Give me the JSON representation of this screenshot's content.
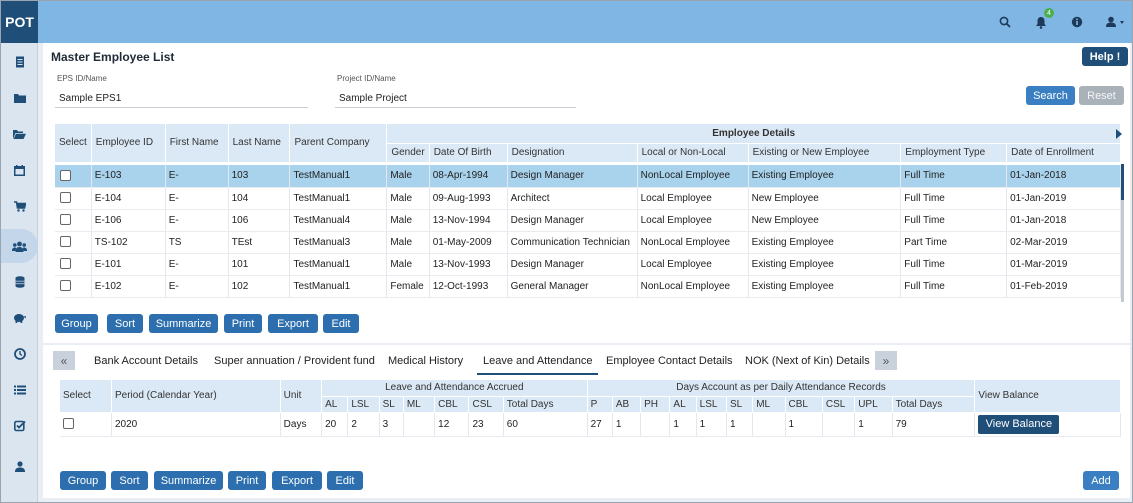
{
  "app": {
    "logo": "POT",
    "notif_count": "4"
  },
  "icons": {
    "search": "search-icon",
    "bell": "bell-icon",
    "info": "info-icon",
    "user": "user-icon"
  },
  "colors": {
    "brand": "#1f4e79",
    "topbar": "#7fb6e4",
    "header": "#dbe9f6",
    "selected_row": "#a9d2ec"
  },
  "page": {
    "title": "Master Employee List",
    "help": "Help !"
  },
  "filters": {
    "eps_label": "EPS ID/Name",
    "eps_value": "Sample EPS1",
    "project_label": "Project ID/Name",
    "project_value": "Sample Project",
    "search": "Search",
    "reset": "Reset"
  },
  "employees": {
    "columns": {
      "select": "Select",
      "id": "Employee ID",
      "first": "First Name",
      "last": "Last Name",
      "company": "Parent Company",
      "group": "Employee Details",
      "gender": "Gender",
      "dob": "Date Of Birth",
      "designation": "Designation",
      "local": "Local or Non-Local",
      "existing": "Existing or New Employee",
      "type": "Employment Type",
      "enroll": "Date of Enrollment"
    },
    "rows": [
      {
        "id": "E-103",
        "first": "E-",
        "last": "103",
        "company": "TestManual1",
        "gender": "Male",
        "dob": "08-Apr-1994",
        "designation": "Design Manager",
        "local": "NonLocal Employee",
        "existing": "Existing Employee",
        "type": "Full Time",
        "enroll": "01-Jan-2018"
      },
      {
        "id": "E-104",
        "first": "E-",
        "last": "104",
        "company": "TestManual1",
        "gender": "Male",
        "dob": "09-Aug-1993",
        "designation": "Architect",
        "local": "Local Employee",
        "existing": "New Employee",
        "type": "Full Time",
        "enroll": "01-Jan-2019"
      },
      {
        "id": "E-106",
        "first": "E-",
        "last": "106",
        "company": "TestManual4",
        "gender": "Male",
        "dob": "13-Nov-1994",
        "designation": "Design Manager",
        "local": "Local Employee",
        "existing": "New Employee",
        "type": "Full Time",
        "enroll": "01-Jan-2018"
      },
      {
        "id": "TS-102",
        "first": "TS",
        "last": "TEst",
        "company": "TestManual3",
        "gender": "Male",
        "dob": "01-May-2009",
        "designation": "Communication Technician",
        "local": "NonLocal Employee",
        "existing": "Existing Employee",
        "type": "Part Time",
        "enroll": "02-Mar-2019"
      },
      {
        "id": "E-101",
        "first": "E-",
        "last": "101",
        "company": "TestManual1",
        "gender": "Male",
        "dob": "13-Nov-1993",
        "designation": "Design Manager",
        "local": "Local Employee",
        "existing": "Existing Employee",
        "type": "Full Time",
        "enroll": "01-Mar-2019"
      },
      {
        "id": "E-102",
        "first": "E-",
        "last": "102",
        "company": "TestManual1",
        "gender": "Female",
        "dob": "12-Oct-1993",
        "designation": "General Manager",
        "local": "NonLocal Employee",
        "existing": "Existing Employee",
        "type": "Full Time",
        "enroll": "01-Feb-2019"
      }
    ]
  },
  "toolbar": {
    "group": "Group",
    "sort": "Sort",
    "summarize": "Summarize",
    "print": "Print",
    "export": "Export",
    "edit": "Edit"
  },
  "tabs": {
    "prev": "«",
    "next": "»",
    "items": [
      "Bank Account Details",
      "Super annuation / Provident fund",
      "Medical History",
      "Leave and Attendance",
      "Employee Contact Details",
      "NOK (Next of Kin) Details"
    ]
  },
  "leave": {
    "columns": {
      "select": "Select",
      "period": "Period (Calendar Year)",
      "unit": "Unit",
      "accrued": "Leave and Attendance Accrued",
      "days": "Days Account as per Daily Attendance Records",
      "view": "View Balance",
      "al": "AL",
      "lsl": "LSL",
      "sl": "SL",
      "ml": "ML",
      "cbl": "CBL",
      "csl": "CSL",
      "total": "Total Days",
      "p": "P",
      "ab": "AB",
      "ph": "PH",
      "upl": "UPL"
    },
    "row": {
      "period": "2020",
      "unit": "Days",
      "al": "20",
      "lsl": "2",
      "sl": "3",
      "ml": "",
      "cbl": "12",
      "csl": "23",
      "total": "60",
      "p": "27",
      "ab": "1",
      "ph": "",
      "d_al": "1",
      "d_lsl": "1",
      "d_sl": "1",
      "d_ml": "",
      "d_cbl": "1",
      "d_csl": "",
      "upl": "1",
      "d_total": "79",
      "view_btn": "View Balance"
    },
    "add": "Add"
  }
}
